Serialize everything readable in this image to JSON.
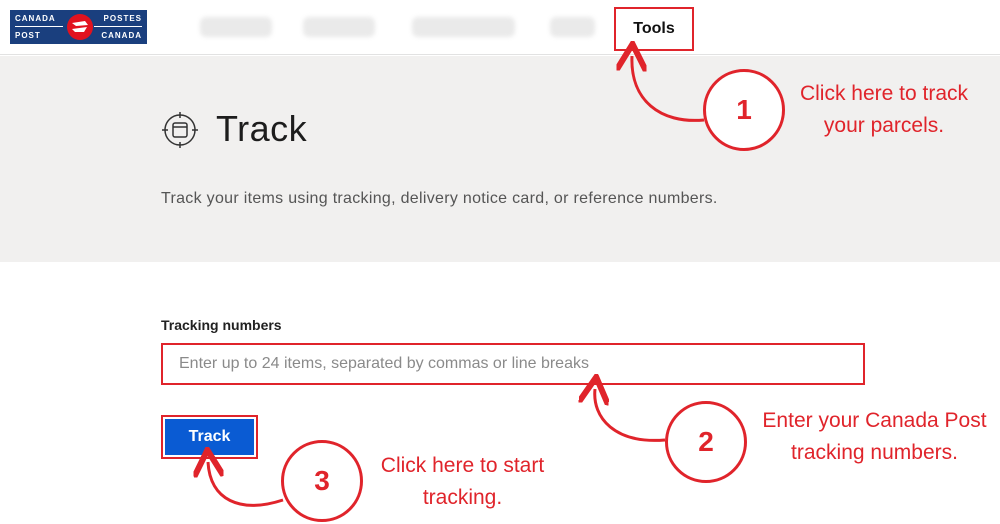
{
  "header": {
    "logo": {
      "top_left": "CANADA",
      "bottom_left": "POST",
      "top_right": "POSTES",
      "bottom_right": "CANADA"
    },
    "tools_tab": "Tools"
  },
  "hero": {
    "title": "Track",
    "description": "Track your items using tracking, delivery notice card, or reference numbers."
  },
  "form": {
    "label": "Tracking numbers",
    "placeholder": "Enter up to 24 items, separated by commas or line breaks",
    "value": "",
    "button_label": "Track"
  },
  "annotations": {
    "step1": {
      "number": "1",
      "line1": "Click here to track",
      "line2": "your parcels."
    },
    "step2": {
      "number": "2",
      "line1": "Enter your Canada Post",
      "line2": "tracking numbers."
    },
    "step3": {
      "number": "3",
      "line1": "Click here to start",
      "line2": "tracking."
    },
    "color": "#e0242b"
  },
  "colors": {
    "brand_blue": "#1a3f7e",
    "brand_red": "#e1121f",
    "button_blue": "#0a5bd3",
    "hero_bg": "#f1f0ef"
  }
}
